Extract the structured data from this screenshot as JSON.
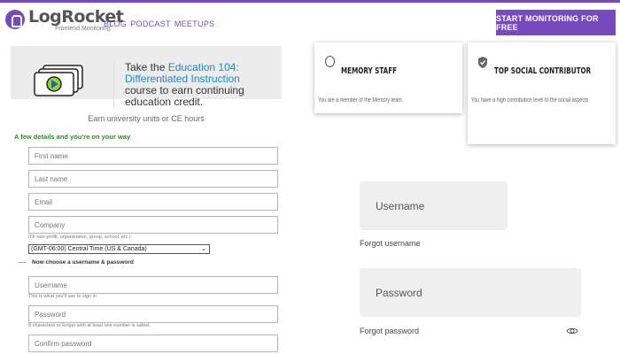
{
  "header": {
    "brand": "LogRocket",
    "brand_sub": "Frontend Monitoring",
    "nav": [
      "BLOG",
      "PODCAST",
      "MEETUPS"
    ],
    "cta": "START MONITORING FOR FREE"
  },
  "promo": {
    "text_before": "Take the ",
    "highlight": "Education 104: Differentiated Instruction",
    "text_after": " course to earn continuing education credit.",
    "footer": "Earn university units or CE hours"
  },
  "badges": [
    {
      "title": "MEMORY STAFF",
      "desc": "You are a member of the Memory team"
    },
    {
      "title": "TOP SOCIAL CONTRIBUTOR",
      "desc": "You have a high contribution level to the social aspects"
    }
  ],
  "register_form": {
    "heading": "A few details and you're on your way",
    "first_name_placeholder": "First name",
    "last_name_placeholder": "Last name",
    "email_placeholder": "Email",
    "company_placeholder": "Company",
    "company_hint": "(Or non-profit, organization, group, school, etc.)",
    "timezone_value": "(GMT-06:00) Central Time (US & Canada)",
    "credentials_heading": "Now choose a username & password",
    "username_placeholder": "Username",
    "username_hint": "This is what you'll use to sign in",
    "password_placeholder": "Password",
    "password_hint": "8 characters or longer with at least one number is safest.",
    "confirm_placeholder": "Confirm password"
  },
  "login_form": {
    "username_placeholder": "Username",
    "forgot_username": "Forgot username",
    "password_placeholder": "Password",
    "forgot_password": "Forgot password"
  },
  "icons": {
    "logo": "logrocket-logo-icon",
    "promo": "video-stack-icon",
    "badge1": "memory-badge-icon",
    "badge2": "shield-check-icon",
    "password_toggle": "eye-icon"
  },
  "colors": {
    "brand": "#764abc",
    "link": "#1a8ac2",
    "form_heading": "#2b8a2b"
  }
}
